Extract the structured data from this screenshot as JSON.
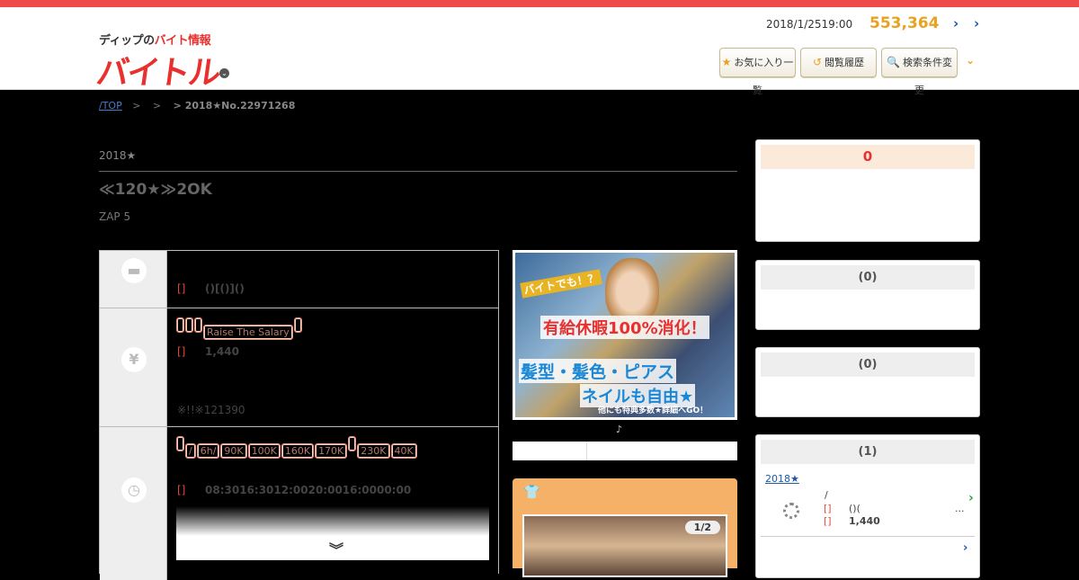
{
  "header": {
    "logo_sub_1": "ディップの",
    "logo_sub_2": "バイト情報",
    "logo_main": "バイトル",
    "datetime": "2018/1/2519:00",
    "job_count": "553,364",
    "buttons": [
      {
        "icon": "★",
        "label": "お気に入り一覧"
      },
      {
        "icon": "↺",
        "label": "閲覧履歴"
      },
      {
        "icon": "🔍",
        "label": "検索条件変更"
      }
    ]
  },
  "breadcrumb": {
    "top": "/TOP",
    "sep1": ">",
    "sep2": ">",
    "current": "> 2018★No.22971268"
  },
  "job": {
    "category": "2018★",
    "title": "≪120★≫2OK",
    "company": "ZAP 5",
    "rows": {
      "work": {
        "label": "[]",
        "value": "()[()]()"
      },
      "pay": {
        "tags": [
          "",
          "",
          "",
          "Raise The Salary",
          ""
        ],
        "label": "[]",
        "value": "1,440",
        "note": "※!!※121390"
      },
      "time": {
        "tags": [
          "",
          "/",
          "6h/",
          "90K",
          "100K",
          "160K",
          "170K",
          "",
          "230K",
          "40K"
        ],
        "label": "[]",
        "value": "08:3016:3012:0020:0016:0000:00"
      }
    }
  },
  "photo": {
    "line1": "バイトでも！？",
    "line2": "有給休暇100%消化！",
    "line3": "髪型・髪色・ピアス",
    "line4": "ネイルも自由★",
    "line5": "他にも特典多数★詳細へGO！"
  },
  "media": {
    "music_note": "♪",
    "counter": "1/2"
  },
  "sidebar": {
    "box1": {
      "header": "0"
    },
    "box2": {
      "header": "(0)"
    },
    "box3": {
      "header": "(0)"
    },
    "box4": {
      "header": "(1)",
      "link": "2018★",
      "slash": "/",
      "label1": "[]",
      "paren": "()(",
      "dots": "...",
      "label2": "[]",
      "value": "1,440"
    }
  },
  "colors": {
    "accent_red": "#e8312f",
    "accent_orange": "#e8a21f",
    "top_bar": "#ef4b4b"
  }
}
